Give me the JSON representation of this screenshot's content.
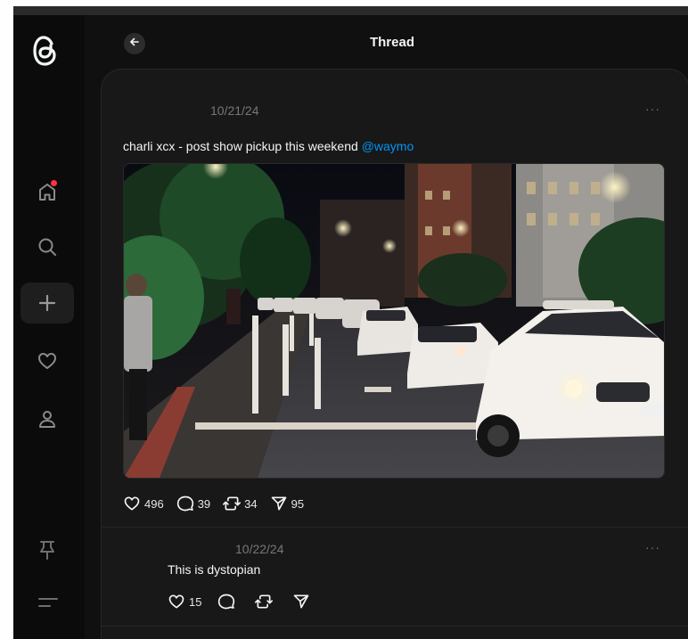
{
  "colors": {
    "background": "#101010",
    "card": "#181818",
    "accent_link": "#0095f6",
    "notification_dot": "#ff3040"
  },
  "sidebar": {
    "logo_icon": "threads-logo-icon",
    "items": [
      {
        "name": "home",
        "icon": "home-icon",
        "has_notification_dot": true
      },
      {
        "name": "search",
        "icon": "search-icon"
      },
      {
        "name": "create",
        "icon": "plus-icon",
        "active": true
      },
      {
        "name": "activity",
        "icon": "heart-icon"
      },
      {
        "name": "profile",
        "icon": "person-icon"
      }
    ],
    "bottom": [
      {
        "name": "pin",
        "icon": "pin-icon"
      },
      {
        "name": "menu",
        "icon": "menu-icon"
      }
    ]
  },
  "header": {
    "title": "Thread",
    "back_icon": "back-arrow-icon"
  },
  "post": {
    "date": "10/21/24",
    "more": "···",
    "text": "charli xcx - post show pickup this weekend",
    "mention": "@waymo",
    "image_alt": "Line of white Waymo self-driving cars along a city street at night",
    "likes": "496",
    "comments": "39",
    "reposts": "34",
    "shares": "95"
  },
  "reply": {
    "date": "10/22/24",
    "more": "···",
    "text": "This is dystopian",
    "likes": "15"
  }
}
